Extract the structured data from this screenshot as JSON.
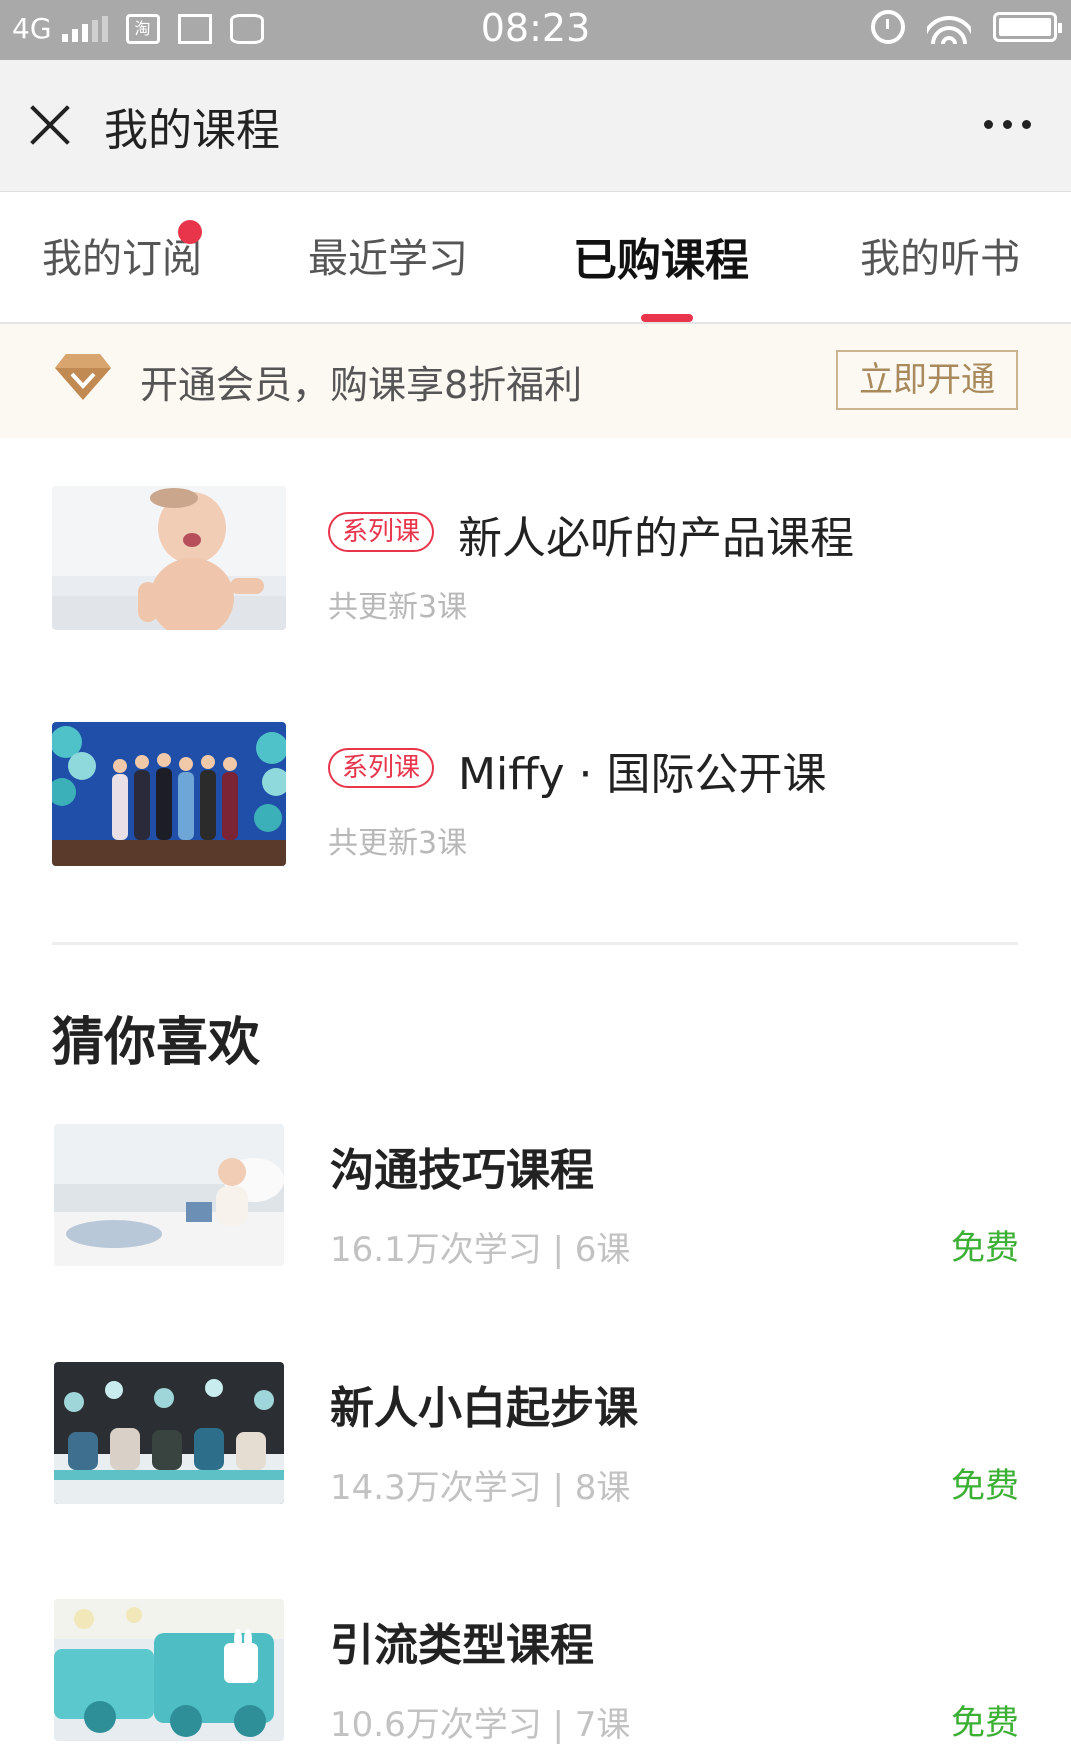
{
  "status_bar": {
    "network": "4G",
    "time": "08:23",
    "notif_icons": [
      "taobao-icon",
      "screenshot-icon",
      "database-icon"
    ]
  },
  "title_bar": {
    "title": "我的课程",
    "close_icon": "close-icon",
    "more_icon": "more-icon"
  },
  "tabs": [
    {
      "label": "我的订阅",
      "active": false,
      "has_dot": true
    },
    {
      "label": "最近学习",
      "active": false,
      "has_dot": false
    },
    {
      "label": "已购课程",
      "active": true,
      "has_dot": false
    },
    {
      "label": "我的听书",
      "active": false,
      "has_dot": false
    }
  ],
  "banner": {
    "text": "开通会员，购课享8折福利",
    "button": "立即开通"
  },
  "purchased": [
    {
      "tag": "系列课",
      "title": "新人必听的产品课程",
      "subtitle": "共更新3课"
    },
    {
      "tag": "系列课",
      "title": "Miffy · 国际公开课",
      "subtitle": "共更新3课"
    }
  ],
  "recommend": {
    "section_title": "猜你喜欢",
    "items": [
      {
        "title": "沟通技巧课程",
        "stats": "16.1万次学习 | 6课",
        "price": "免费"
      },
      {
        "title": "新人小白起步课",
        "stats": "14.3万次学习 | 8课",
        "price": "免费"
      },
      {
        "title": "引流类型课程",
        "stats": "10.6万次学习 | 7课",
        "price": "免费"
      }
    ]
  },
  "colors": {
    "accent": "#e8354c",
    "free_green": "#3cb034",
    "member_gold": "#c9b48f"
  }
}
